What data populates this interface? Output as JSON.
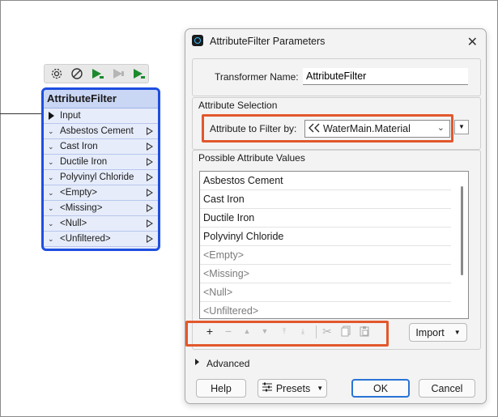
{
  "node": {
    "title": "AttributeFilter",
    "input_port": "Input",
    "output_ports": [
      "Asbestos Cement",
      "Cast Iron",
      "Ductile Iron",
      "Polyvinyl Chloride",
      "<Empty>",
      "<Missing>",
      "<Null>",
      "<Unfiltered>"
    ]
  },
  "node_toolbar": {
    "icons": [
      "gear-icon",
      "disable-icon",
      "run-to-this-icon",
      "run-from-this-icon",
      "run-only-this-icon"
    ]
  },
  "dialog": {
    "title": "AttributeFilter Parameters",
    "transformer_name_label": "Transformer Name:",
    "transformer_name_value": "AttributeFilter",
    "attribute_selection_label": "Attribute Selection",
    "attribute_to_filter_label": "Attribute to Filter by:",
    "attribute_to_filter_value": "WaterMain.Material",
    "possible_values_label": "Possible Attribute Values",
    "values": [
      "Asbestos Cement",
      "Cast Iron",
      "Ductile Iron",
      "Polyvinyl Chloride",
      "<Empty>",
      "<Missing>",
      "<Null>",
      "<Unfiltered>"
    ],
    "import_label": "Import",
    "advanced_label": "Advanced",
    "help_label": "Help",
    "presets_label": "Presets",
    "ok_label": "OK",
    "cancel_label": "Cancel"
  },
  "colors": {
    "highlight": "#e2582c",
    "node_border": "#1f4ee0",
    "ok_border": "#2a73d6"
  }
}
